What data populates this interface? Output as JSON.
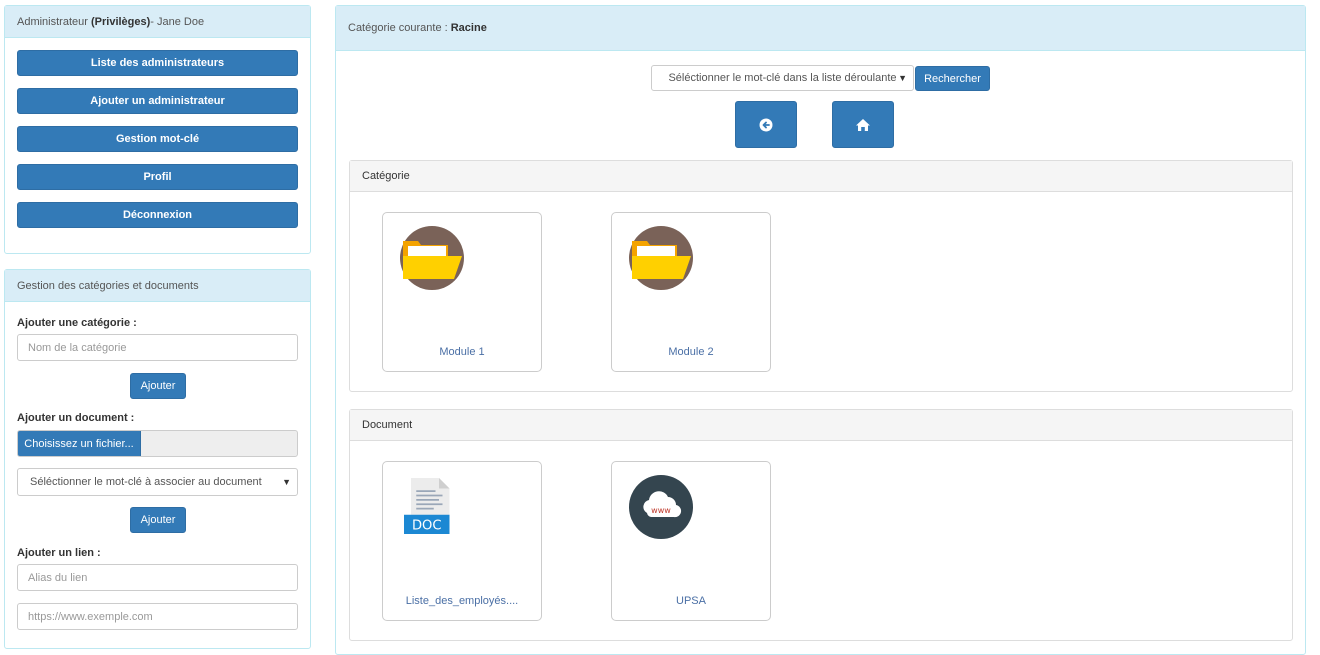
{
  "admin_panel": {
    "title_prefix": "Administrateur",
    "title_bold": "(Privilèges)",
    "title_suffix": " - Jane Doe",
    "buttons": [
      "Liste des administrateurs",
      "Ajouter un administrateur",
      "Gestion mot-clé",
      "Profil",
      "Déconnexion"
    ]
  },
  "manage_panel": {
    "title": "Gestion des catégories et documents",
    "add_category_label": "Ajouter une catégorie :",
    "category_placeholder": "Nom de la catégorie",
    "add_button": "Ajouter",
    "add_document_label": "Ajouter un document :",
    "choose_file_button": "Choisissez un fichier...",
    "keyword_select": "Séléctionner le mot-clé à associer au document",
    "add_link_label": "Ajouter un lien :",
    "link_alias_placeholder": "Alias du lien",
    "link_url_placeholder": "https://www.exemple.com"
  },
  "main": {
    "current_label": "Catégorie courante : ",
    "current_value": "Racine",
    "search_select": "Séléctionner le mot-clé dans la liste déroulante",
    "search_button": "Rechercher",
    "category_heading": "Catégorie",
    "categories": [
      "Module 1",
      "Module 2"
    ],
    "document_heading": "Document",
    "doc_badge": "DOC",
    "www_badge": "www",
    "documents": [
      "Liste_des_employés....",
      "UPSA"
    ]
  },
  "colors": {
    "primary": "#337ab7",
    "heading_bg": "#d9edf7",
    "folder_circle": "#7a6258",
    "folder_yellow": "#ffd000",
    "doc_blue": "#1c88d3",
    "web_circle": "#34454f"
  },
  "icons": [
    "folder-icon",
    "doc-file-icon",
    "www-cloud-icon",
    "back-arrow-icon",
    "home-icon",
    "caret-down-icon"
  ]
}
